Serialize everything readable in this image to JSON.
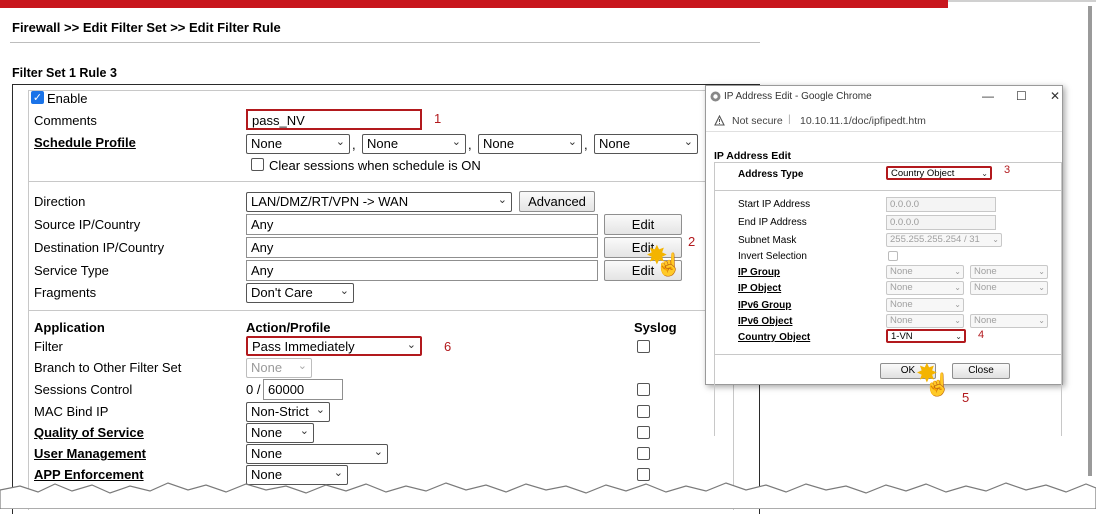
{
  "breadcrumb": "Firewall >> Edit Filter Set >> Edit Filter Rule",
  "filter_set_title": "Filter Set 1 Rule 3",
  "form": {
    "enable_label": "Enable",
    "enable_checked": true,
    "comments_label": "Comments",
    "comments_value": "pass_NV",
    "schedule_profile_label": "Schedule Profile",
    "schedule_options": [
      "None",
      "None",
      "None",
      "None"
    ],
    "clear_sessions_label": "Clear sessions when schedule is ON",
    "direction_label": "Direction",
    "direction_value": "LAN/DMZ/RT/VPN -> WAN",
    "advanced_label": "Advanced",
    "source_label": "Source IP/Country",
    "source_value": "Any",
    "destination_label": "Destination IP/Country",
    "destination_value": "Any",
    "service_label": "Service Type",
    "service_value": "Any",
    "edit_label": "Edit",
    "fragments_label": "Fragments",
    "fragments_value": "Don't Care",
    "application_header": "Application",
    "action_header": "Action/Profile",
    "syslog_header": "Syslog",
    "filter_label": "Filter",
    "filter_value": "Pass Immediately",
    "branch_label": "Branch to Other Filter Set",
    "branch_value": "None",
    "sessions_label": "Sessions Control",
    "sessions_prefix": "0 /",
    "sessions_value": "60000",
    "mac_bind_label": "MAC Bind IP",
    "mac_bind_value": "Non-Strict",
    "qos_label": "Quality of Service",
    "qos_value": "None",
    "user_mgmt_label": "User Management",
    "user_mgmt_value": "None",
    "app_enf_label": "APP Enforcement",
    "app_enf_value": "None"
  },
  "popup": {
    "window_title": "IP Address Edit - Google Chrome",
    "not_secure": "Not secure",
    "url": "10.10.11.1/doc/ipfipedt.htm",
    "section_title": "IP Address Edit",
    "address_type_label": "Address Type",
    "address_type_value": "Country Object",
    "start_ip_label": "Start IP Address",
    "start_ip_value": "0.0.0.0",
    "end_ip_label": "End IP Address",
    "end_ip_value": "0.0.0.0",
    "subnet_label": "Subnet Mask",
    "subnet_value": "255.255.255.254 / 31",
    "invert_label": "Invert Selection",
    "ip_group_label": "IP Group",
    "ip_object_label": "IP Object",
    "ipv6_group_label": "IPv6 Group",
    "ipv6_object_label": "IPv6 Object",
    "none_value": "None",
    "country_object_label": "Country Object",
    "country_object_value": "1-VN",
    "ok_label": "OK",
    "close_label": "Close"
  },
  "steps": [
    "1",
    "2",
    "3",
    "4",
    "5",
    "6"
  ],
  "colors": {
    "accent_red": "#b2191d",
    "top_bar": "#c8161d",
    "checkbox_blue": "#1a73e8"
  },
  "icons": [
    "chrome-icon",
    "info-icon",
    "minimize-icon",
    "maximize-icon",
    "close-icon",
    "pointer-hand-icon",
    "click-burst-icon"
  ]
}
